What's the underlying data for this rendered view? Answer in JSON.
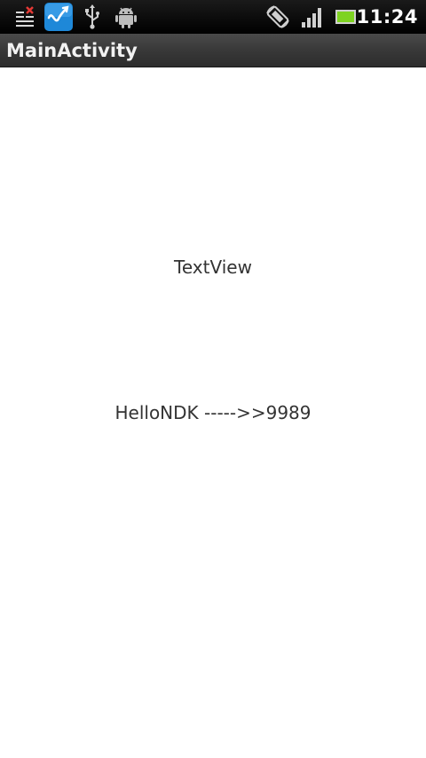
{
  "status_bar": {
    "time": "11:24",
    "icons": [
      "task-killer-icon",
      "app-notification-icon",
      "usb-icon",
      "android-debug-icon",
      "rotate-icon",
      "signal-icon",
      "battery-icon"
    ]
  },
  "title_bar": {
    "title": "MainActivity"
  },
  "content": {
    "text_view_1": "TextView",
    "text_view_2": "HelloNDK ----->>9989"
  },
  "colors": {
    "status_bar_bg": "#000000",
    "title_bar_bg": "#3a3a3a",
    "content_bg": "#ffffff",
    "text": "#333333",
    "notification_accent": "#1e88d8",
    "battery_green": "#7ed321"
  }
}
